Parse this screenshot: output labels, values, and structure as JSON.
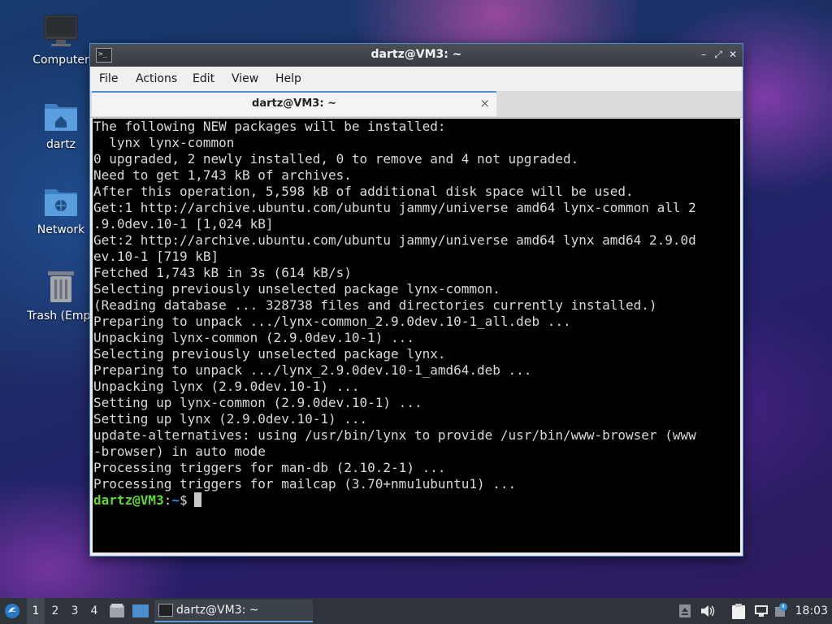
{
  "desktop": {
    "icons": [
      {
        "label": "Computer"
      },
      {
        "label": "dartz"
      },
      {
        "label": "Network"
      },
      {
        "label": "Trash (Empt"
      }
    ]
  },
  "window": {
    "title": "dartz@VM3: ~",
    "menu": [
      "File",
      "Actions",
      "Edit",
      "View",
      "Help"
    ],
    "tab_title": "dartz@VM3: ~",
    "tab_close": "×",
    "controls": {
      "minimize": "–",
      "maximize": "⤢",
      "close": "✕"
    }
  },
  "terminal": {
    "lines": [
      "The following NEW packages will be installed:",
      "  lynx lynx-common",
      "0 upgraded, 2 newly installed, 0 to remove and 4 not upgraded.",
      "Need to get 1,743 kB of archives.",
      "After this operation, 5,598 kB of additional disk space will be used.",
      "Get:1 http://archive.ubuntu.com/ubuntu jammy/universe amd64 lynx-common all 2",
      ".9.0dev.10-1 [1,024 kB]",
      "Get:2 http://archive.ubuntu.com/ubuntu jammy/universe amd64 lynx amd64 2.9.0d",
      "ev.10-1 [719 kB]",
      "Fetched 1,743 kB in 3s (614 kB/s)",
      "Selecting previously unselected package lynx-common.",
      "(Reading database ... 328738 files and directories currently installed.)",
      "Preparing to unpack .../lynx-common_2.9.0dev.10-1_all.deb ...",
      "Unpacking lynx-common (2.9.0dev.10-1) ...",
      "Selecting previously unselected package lynx.",
      "Preparing to unpack .../lynx_2.9.0dev.10-1_amd64.deb ...",
      "Unpacking lynx (2.9.0dev.10-1) ...",
      "Setting up lynx-common (2.9.0dev.10-1) ...",
      "Setting up lynx (2.9.0dev.10-1) ...",
      "update-alternatives: using /usr/bin/lynx to provide /usr/bin/www-browser (www",
      "-browser) in auto mode",
      "Processing triggers for man-db (2.10.2-1) ...",
      "Processing triggers for mailcap (3.70+nmu1ubuntu1) ..."
    ],
    "prompt": {
      "user": "dartz@VM3",
      "sep": ":",
      "path": "~",
      "symbol": "$"
    }
  },
  "taskbar": {
    "workspaces": [
      "1",
      "2",
      "3",
      "4"
    ],
    "active_workspace": "1",
    "task_label": "dartz@VM3: ~",
    "clock": "18:03",
    "tray_icons": [
      "eject-icon",
      "volume-icon",
      "clipboard-icon",
      "network-icon",
      "update-notifier-icon"
    ]
  },
  "colors": {
    "window_border": "#4b8fd1",
    "prompt_user": "#5fd738",
    "prompt_path": "#3c8be0",
    "terminal_bg": "#000000",
    "taskbar_bg": "#2f343b"
  }
}
